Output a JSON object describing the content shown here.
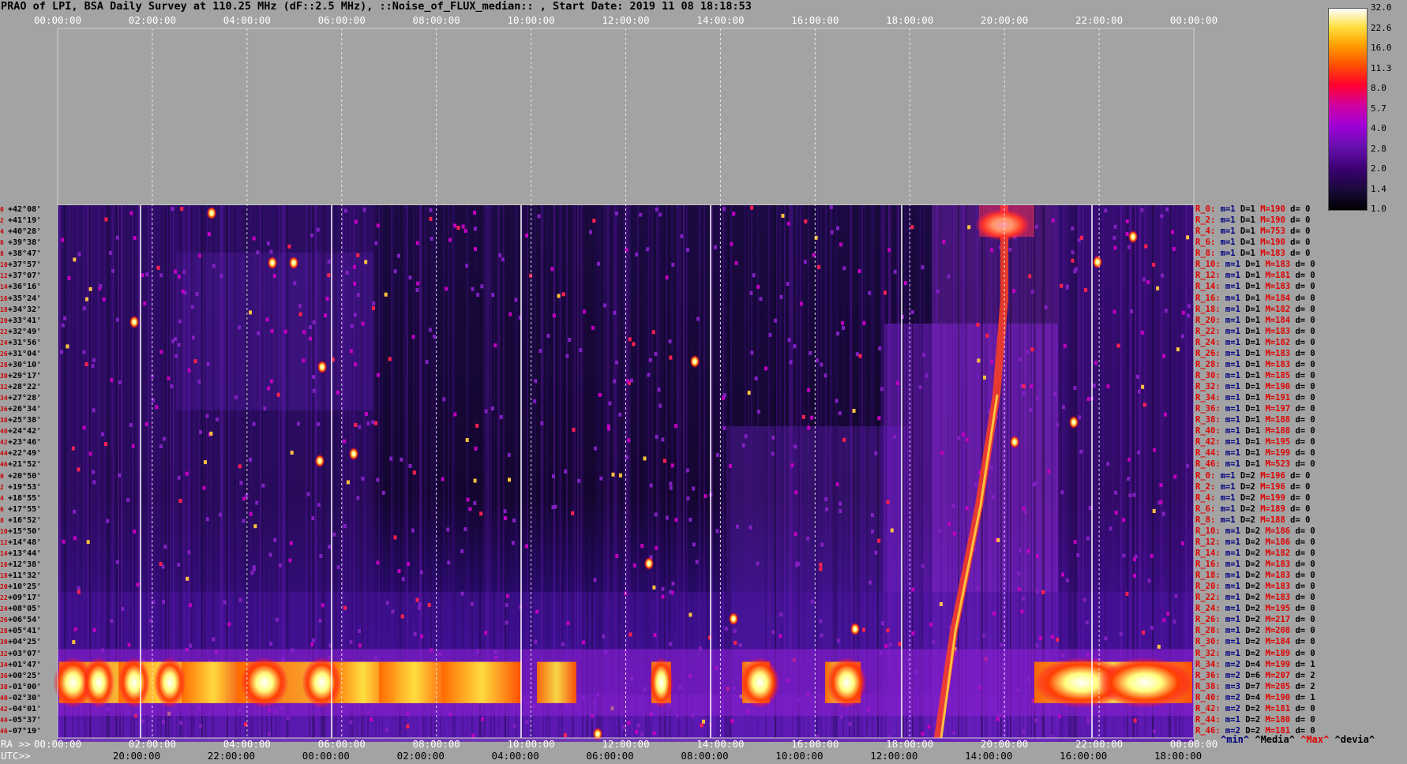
{
  "title": "PRAO of LPI, BSA Daily Survey at 110.25 MHz (dF::2.5 MHz), ::Noise_of_FLUX_median:: , Start Date: 2019 11 08 18:18:53",
  "axis_labels": {
    "ra": "RA >>",
    "utc": "UTC>>"
  },
  "stats_header": {
    "min": "^min^",
    "media": "^Media^",
    "max": "^Max^",
    "devia": "^devia^"
  },
  "colors": {
    "background": "#a3a3a3",
    "max_label": "#e00000",
    "min_label": "#000080"
  },
  "chart_data": {
    "type": "heatmap",
    "title": "PRAO of LPI, BSA Daily Survey at 110.25 MHz (dF::2.5 MHz), ::Noise_of_FLUX_median:: , Start Date: 2019 11 08 18:18:53",
    "x_top_ticks": [
      "00:00:00",
      "02:00:00",
      "04:00:00",
      "06:00:00",
      "08:00:00",
      "10:00:00",
      "12:00:00",
      "14:00:00",
      "16:00:00",
      "18:00:00",
      "20:00:00",
      "22:00:00",
      "00:00:00"
    ],
    "x_ra_ticks": [
      "00:00:00",
      "02:00:00",
      "04:00:00",
      "06:00:00",
      "08:00:00",
      "10:00:00",
      "12:00:00",
      "14:00:00",
      "16:00:00",
      "18:00:00",
      "20:00:00",
      "22:00:00",
      "00:00:00"
    ],
    "x_utc_ticks": [
      "20:00:00",
      "22:00:00",
      "00:00:00",
      "02:00:00",
      "04:00:00",
      "06:00:00",
      "08:00:00",
      "10:00:00",
      "12:00:00",
      "14:00:00",
      "16:00:00",
      "18:00:00"
    ],
    "y_ticks": [
      "+42°08'",
      "+41°19'",
      "+40°28'",
      "+39°38'",
      "+38°47'",
      "+37°57'",
      "+37°07'",
      "+36°16'",
      "+35°24'",
      "+34°32'",
      "+33°41'",
      "+32°49'",
      "+31°56'",
      "+31°04'",
      "+30°10'",
      "+29°17'",
      "+28°22'",
      "+27°28'",
      "+26°34'",
      "+25°38'",
      "+24°42'",
      "+23°46'",
      "+22°49'",
      "+21°52'",
      "+20°50'",
      "+19°53'",
      "+18°55'",
      "+17°55'",
      "+16°52'",
      "+15°50'",
      "+14°48'",
      "+13°44'",
      "+12°38'",
      "+11°32'",
      "+10°25'",
      "+09°17'",
      "+08°05'",
      "+06°54'",
      "+05°41'",
      "+04°25'",
      "+03°07'",
      "+01°47'",
      "+00°25'",
      "-01°00'",
      "-02°30'",
      "-04°01'",
      "-05°37'",
      "-07°19'"
    ],
    "y_index": [
      "0",
      "2",
      "4",
      "6",
      "8",
      "10",
      "12",
      "14",
      "16",
      "18",
      "20",
      "22",
      "24",
      "26",
      "28",
      "30",
      "32",
      "34",
      "36",
      "38",
      "40",
      "42",
      "44",
      "46",
      "0",
      "2",
      "4",
      "6",
      "8",
      "10",
      "12",
      "14",
      "16",
      "18",
      "20",
      "22",
      "24",
      "26",
      "28",
      "30",
      "32",
      "34",
      "36",
      "38",
      "40",
      "42",
      "44",
      "46"
    ],
    "colorbar": {
      "ticks": [
        "32.0",
        "22.6",
        "16.0",
        "11.3",
        "8.0",
        "5.7",
        "4.0",
        "2.8",
        "2.0",
        "1.4",
        "1.0"
      ],
      "range": [
        1.0,
        32.0
      ],
      "scale": "log"
    },
    "rows": [
      {
        "r": "R_0:",
        "m": "m=1",
        "D": "D=1",
        "M": "M=190",
        "d": "d= 0"
      },
      {
        "r": "R_2:",
        "m": "m=1",
        "D": "D=1",
        "M": "M=190",
        "d": "d= 0"
      },
      {
        "r": "R_4:",
        "m": "m=1",
        "D": "D=1",
        "M": "M=753",
        "d": "d= 0"
      },
      {
        "r": "R_6:",
        "m": "m=1",
        "D": "D=1",
        "M": "M=190",
        "d": "d= 0"
      },
      {
        "r": "R_8:",
        "m": "m=1",
        "D": "D=1",
        "M": "M=183",
        "d": "d= 0"
      },
      {
        "r": "R_10:",
        "m": "m=1",
        "D": "D=1",
        "M": "M=183",
        "d": "d= 0"
      },
      {
        "r": "R_12:",
        "m": "m=1",
        "D": "D=1",
        "M": "M=181",
        "d": "d= 0"
      },
      {
        "r": "R_14:",
        "m": "m=1",
        "D": "D=1",
        "M": "M=183",
        "d": "d= 0"
      },
      {
        "r": "R_16:",
        "m": "m=1",
        "D": "D=1",
        "M": "M=184",
        "d": "d= 0"
      },
      {
        "r": "R_18:",
        "m": "m=1",
        "D": "D=1",
        "M": "M=182",
        "d": "d= 0"
      },
      {
        "r": "R_20:",
        "m": "m=1",
        "D": "D=1",
        "M": "M=184",
        "d": "d= 0"
      },
      {
        "r": "R_22:",
        "m": "m=1",
        "D": "D=1",
        "M": "M=183",
        "d": "d= 0"
      },
      {
        "r": "R_24:",
        "m": "m=1",
        "D": "D=1",
        "M": "M=182",
        "d": "d= 0"
      },
      {
        "r": "R_26:",
        "m": "m=1",
        "D": "D=1",
        "M": "M=183",
        "d": "d= 0"
      },
      {
        "r": "R_28:",
        "m": "m=1",
        "D": "D=1",
        "M": "M=183",
        "d": "d= 0"
      },
      {
        "r": "R_30:",
        "m": "m=1",
        "D": "D=1",
        "M": "M=185",
        "d": "d= 0"
      },
      {
        "r": "R_32:",
        "m": "m=1",
        "D": "D=1",
        "M": "M=190",
        "d": "d= 0"
      },
      {
        "r": "R_34:",
        "m": "m=1",
        "D": "D=1",
        "M": "M=191",
        "d": "d= 0"
      },
      {
        "r": "R_36:",
        "m": "m=1",
        "D": "D=1",
        "M": "M=197",
        "d": "d= 0"
      },
      {
        "r": "R_38:",
        "m": "m=1",
        "D": "D=1",
        "M": "M=188",
        "d": "d= 0"
      },
      {
        "r": "R_40:",
        "m": "m=1",
        "D": "D=1",
        "M": "M=188",
        "d": "d= 0"
      },
      {
        "r": "R_42:",
        "m": "m=1",
        "D": "D=1",
        "M": "M=195",
        "d": "d= 0"
      },
      {
        "r": "R_44:",
        "m": "m=1",
        "D": "D=1",
        "M": "M=199",
        "d": "d= 0"
      },
      {
        "r": "R_46:",
        "m": "m=1",
        "D": "D=1",
        "M": "M=523",
        "d": "d= 0"
      },
      {
        "r": "R_0:",
        "m": "m=1",
        "D": "D=2",
        "M": "M=196",
        "d": "d= 0"
      },
      {
        "r": "R_2:",
        "m": "m=1",
        "D": "D=2",
        "M": "M=196",
        "d": "d= 0"
      },
      {
        "r": "R_4:",
        "m": "m=1",
        "D": "D=2",
        "M": "M=199",
        "d": "d= 0"
      },
      {
        "r": "R_6:",
        "m": "m=1",
        "D": "D=2",
        "M": "M=189",
        "d": "d= 0"
      },
      {
        "r": "R_8:",
        "m": "m=1",
        "D": "D=2",
        "M": "M=188",
        "d": "d= 0"
      },
      {
        "r": "R_10:",
        "m": "m=1",
        "D": "D=2",
        "M": "M=186",
        "d": "d= 0"
      },
      {
        "r": "R_12:",
        "m": "m=1",
        "D": "D=2",
        "M": "M=186",
        "d": "d= 0"
      },
      {
        "r": "R_14:",
        "m": "m=1",
        "D": "D=2",
        "M": "M=182",
        "d": "d= 0"
      },
      {
        "r": "R_16:",
        "m": "m=1",
        "D": "D=2",
        "M": "M=183",
        "d": "d= 0"
      },
      {
        "r": "R_18:",
        "m": "m=1",
        "D": "D=2",
        "M": "M=183",
        "d": "d= 0"
      },
      {
        "r": "R_20:",
        "m": "m=1",
        "D": "D=2",
        "M": "M=183",
        "d": "d= 0"
      },
      {
        "r": "R_22:",
        "m": "m=1",
        "D": "D=2",
        "M": "M=183",
        "d": "d= 0"
      },
      {
        "r": "R_24:",
        "m": "m=1",
        "D": "D=2",
        "M": "M=195",
        "d": "d= 0"
      },
      {
        "r": "R_26:",
        "m": "m=1",
        "D": "D=2",
        "M": "M=217",
        "d": "d= 0"
      },
      {
        "r": "R_28:",
        "m": "m=1",
        "D": "D=2",
        "M": "M=208",
        "d": "d= 0"
      },
      {
        "r": "R_30:",
        "m": "m=1",
        "D": "D=2",
        "M": "M=184",
        "d": "d= 0"
      },
      {
        "r": "R_32:",
        "m": "m=1",
        "D": "D=2",
        "M": "M=189",
        "d": "d= 0"
      },
      {
        "r": "R_34:",
        "m": "m=2",
        "D": "D=4",
        "M": "M=199",
        "d": "d= 1"
      },
      {
        "r": "R_36:",
        "m": "m=2",
        "D": "D=6",
        "M": "M=207",
        "d": "d= 2"
      },
      {
        "r": "R_38:",
        "m": "m=3",
        "D": "D=7",
        "M": "M=205",
        "d": "d= 2"
      },
      {
        "r": "R_40:",
        "m": "m=2",
        "D": "D=4",
        "M": "M=190",
        "d": "d= 1"
      },
      {
        "r": "R_42:",
        "m": "m=2",
        "D": "D=2",
        "M": "M=181",
        "d": "d= 0"
      },
      {
        "r": "R_44:",
        "m": "m=1",
        "D": "D=2",
        "M": "M=180",
        "d": "d= 0"
      },
      {
        "r": "R_46:",
        "m": "m=2",
        "D": "D=2",
        "M": "M=181",
        "d": "d= 0"
      }
    ]
  }
}
